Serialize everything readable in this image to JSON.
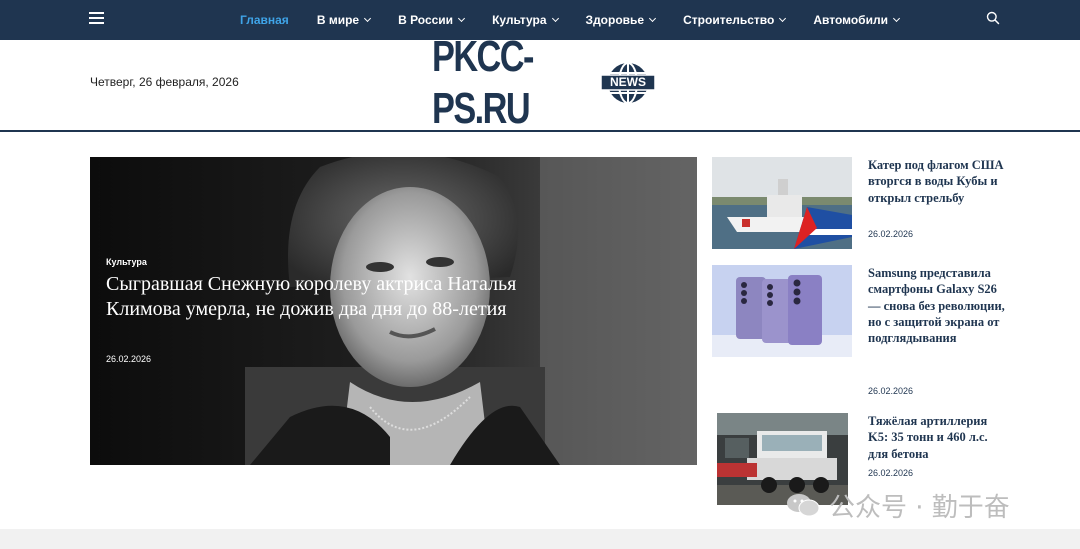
{
  "nav": {
    "items": [
      {
        "label": "Главная",
        "active": true,
        "has_dropdown": false
      },
      {
        "label": "В мире",
        "active": false,
        "has_dropdown": true
      },
      {
        "label": "В России",
        "active": false,
        "has_dropdown": true
      },
      {
        "label": "Культура",
        "active": false,
        "has_dropdown": true
      },
      {
        "label": "Здоровье",
        "active": false,
        "has_dropdown": true
      },
      {
        "label": "Строительство",
        "active": false,
        "has_dropdown": true
      },
      {
        "label": "Автомобили",
        "active": false,
        "has_dropdown": true
      }
    ],
    "icons": {
      "menu": "hamburger-icon",
      "search": "search-icon"
    }
  },
  "header": {
    "date": "Четверг, 26 февраля, 2026",
    "logo_text": "PKCC-PS.RU",
    "logo_badge": "NEWS"
  },
  "feature": {
    "category": "Культура",
    "title": "Сыгравшая Снежную королеву актриса Наталья Климова умерла, не дожив два дня до 88-летия",
    "date": "26.02.2026"
  },
  "side_news": [
    {
      "title": "Катер под флагом США вторгся в воды Кубы и открыл стрельбу",
      "date": "26.02.2026"
    },
    {
      "title": "Samsung представила смартфоны Galaxy S26 — снова без революции, но с защитой экрана от подглядывания",
      "date": "26.02.2026"
    },
    {
      "title": "Тяжёлая артиллерия K5: 35 тонн и 460 л.с. для бетона",
      "date": "26.02.2026"
    }
  ],
  "watermark": "公众号 · 勤于奋",
  "colors": {
    "nav_bg": "#1f3550",
    "active": "#3fa4e8",
    "headline": "#1f3550"
  }
}
